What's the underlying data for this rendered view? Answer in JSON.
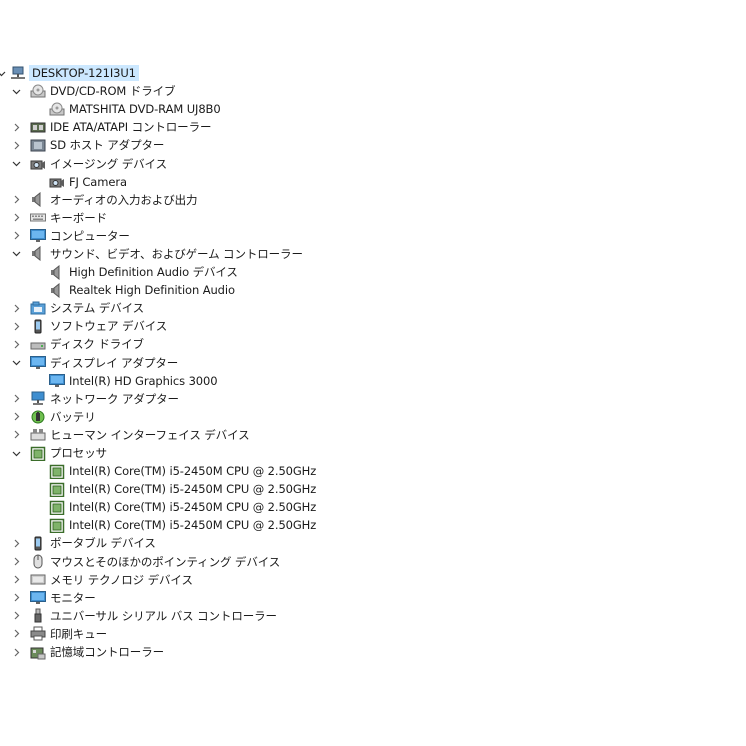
{
  "tree": [
    {
      "id": "root",
      "level": 0,
      "expanded": true,
      "icon": "computer-network-icon",
      "label": "DESKTOP-121I3U1"
    },
    {
      "id": "dvd",
      "level": 1,
      "expanded": true,
      "icon": "disc-drive-icon",
      "label": "DVD/CD-ROM ドライブ"
    },
    {
      "id": "dvd-1",
      "level": 2,
      "icon": "disc-drive-icon",
      "label": "MATSHITA DVD-RAM UJ8B0"
    },
    {
      "id": "ide",
      "level": 1,
      "expanded": false,
      "icon": "ide-controller-icon",
      "label": "IDE ATA/ATAPI コントローラー"
    },
    {
      "id": "sd",
      "level": 1,
      "expanded": false,
      "icon": "sd-host-icon",
      "label": "SD ホスト アダプター"
    },
    {
      "id": "imaging",
      "level": 1,
      "expanded": true,
      "icon": "camera-icon",
      "label": "イメージング デバイス"
    },
    {
      "id": "imaging-1",
      "level": 2,
      "icon": "camera-icon",
      "label": "FJ Camera"
    },
    {
      "id": "audio-io",
      "level": 1,
      "expanded": false,
      "icon": "speaker-icon",
      "label": "オーディオの入力および出力"
    },
    {
      "id": "keyboard",
      "level": 1,
      "expanded": false,
      "icon": "keyboard-icon",
      "label": "キーボード"
    },
    {
      "id": "computer",
      "level": 1,
      "expanded": false,
      "icon": "monitor-icon",
      "label": "コンピューター"
    },
    {
      "id": "sound",
      "level": 1,
      "expanded": true,
      "icon": "speaker-icon",
      "label": "サウンド、ビデオ、およびゲーム コントローラー"
    },
    {
      "id": "sound-1",
      "level": 2,
      "icon": "speaker-icon",
      "label": "High Definition Audio デバイス"
    },
    {
      "id": "sound-2",
      "level": 2,
      "icon": "speaker-icon",
      "label": "Realtek High Definition Audio"
    },
    {
      "id": "system",
      "level": 1,
      "expanded": false,
      "icon": "system-folder-icon",
      "label": "システム デバイス"
    },
    {
      "id": "software",
      "level": 1,
      "expanded": false,
      "icon": "phone-icon",
      "label": "ソフトウェア デバイス"
    },
    {
      "id": "disk",
      "level": 1,
      "expanded": false,
      "icon": "disk-drive-icon",
      "label": "ディスク ドライブ"
    },
    {
      "id": "display",
      "level": 1,
      "expanded": true,
      "icon": "monitor-icon",
      "label": "ディスプレイ アダプター"
    },
    {
      "id": "display-1",
      "level": 2,
      "icon": "monitor-icon",
      "label": "Intel(R) HD Graphics 3000"
    },
    {
      "id": "network",
      "level": 1,
      "expanded": false,
      "icon": "network-icon",
      "label": "ネットワーク アダプター"
    },
    {
      "id": "battery",
      "level": 1,
      "expanded": false,
      "icon": "battery-icon",
      "label": "バッテリ"
    },
    {
      "id": "hid",
      "level": 1,
      "expanded": false,
      "icon": "hid-icon",
      "label": "ヒューマン インターフェイス デバイス"
    },
    {
      "id": "processor",
      "level": 1,
      "expanded": true,
      "icon": "processor-icon",
      "label": "プロセッサ"
    },
    {
      "id": "cpu-1",
      "level": 2,
      "icon": "processor-icon",
      "label": "Intel(R) Core(TM) i5-2450M CPU @ 2.50GHz"
    },
    {
      "id": "cpu-2",
      "level": 2,
      "icon": "processor-icon",
      "label": "Intel(R) Core(TM) i5-2450M CPU @ 2.50GHz"
    },
    {
      "id": "cpu-3",
      "level": 2,
      "icon": "processor-icon",
      "label": "Intel(R) Core(TM) i5-2450M CPU @ 2.50GHz"
    },
    {
      "id": "cpu-4",
      "level": 2,
      "icon": "processor-icon",
      "label": "Intel(R) Core(TM) i5-2450M CPU @ 2.50GHz"
    },
    {
      "id": "portable",
      "level": 1,
      "expanded": false,
      "icon": "phone-icon",
      "label": "ポータブル デバイス"
    },
    {
      "id": "mouse",
      "level": 1,
      "expanded": false,
      "icon": "mouse-icon",
      "label": "マウスとそのほかのポインティング デバイス"
    },
    {
      "id": "memory",
      "level": 1,
      "expanded": false,
      "icon": "memory-card-icon",
      "label": "メモリ テクノロジ デバイス"
    },
    {
      "id": "monitor",
      "level": 1,
      "expanded": false,
      "icon": "monitor-icon",
      "label": "モニター"
    },
    {
      "id": "usb",
      "level": 1,
      "expanded": false,
      "icon": "usb-icon",
      "label": "ユニバーサル シリアル バス コントローラー"
    },
    {
      "id": "print",
      "level": 1,
      "expanded": false,
      "icon": "printer-icon",
      "label": "印刷キュー"
    },
    {
      "id": "storage",
      "level": 1,
      "expanded": false,
      "icon": "storage-controller-icon",
      "label": "記憶域コントローラー"
    }
  ]
}
